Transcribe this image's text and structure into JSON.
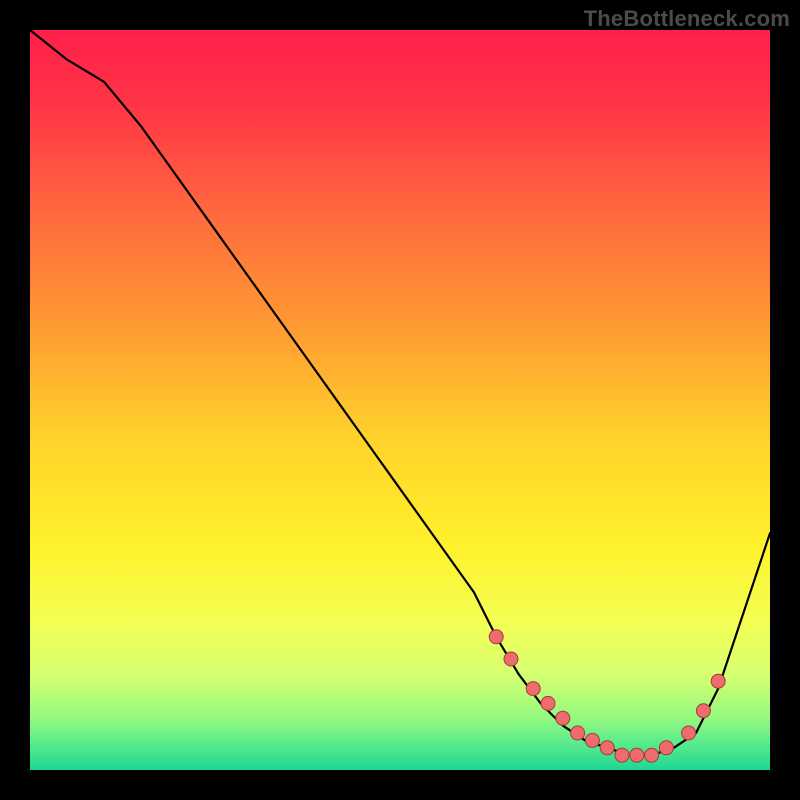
{
  "watermark": "TheBottleneck.com",
  "colors": {
    "background": "#000000",
    "gradient_stops": [
      {
        "offset": 0.0,
        "color": "#ff1f4a"
      },
      {
        "offset": 0.1,
        "color": "#ff3446"
      },
      {
        "offset": 0.25,
        "color": "#ff6a3e"
      },
      {
        "offset": 0.4,
        "color": "#ff9a33"
      },
      {
        "offset": 0.55,
        "color": "#ffd22a"
      },
      {
        "offset": 0.7,
        "color": "#fff22c"
      },
      {
        "offset": 0.8,
        "color": "#f3ff54"
      },
      {
        "offset": 0.87,
        "color": "#d6ff70"
      },
      {
        "offset": 0.93,
        "color": "#94f97f"
      },
      {
        "offset": 0.97,
        "color": "#4fe88e"
      },
      {
        "offset": 1.0,
        "color": "#1fd693"
      }
    ],
    "curve": "#000000",
    "marker_fill": "#ee6b6e",
    "marker_stroke": "#a83a3c"
  },
  "chart_data": {
    "type": "line",
    "title": "",
    "xlabel": "",
    "ylabel": "",
    "xlim": [
      0,
      100
    ],
    "ylim": [
      0,
      100
    ],
    "series": [
      {
        "name": "bottleneck-curve",
        "x": [
          0,
          5,
          10,
          15,
          20,
          25,
          30,
          35,
          40,
          45,
          50,
          55,
          60,
          63,
          66,
          69,
          72,
          75,
          78,
          81,
          84,
          87,
          90,
          93,
          96,
          100
        ],
        "y": [
          100,
          96,
          93,
          87,
          80,
          73,
          66,
          59,
          52,
          45,
          38,
          31,
          24,
          18,
          13,
          9,
          6,
          4,
          3,
          2,
          2,
          3,
          5,
          11,
          20,
          32
        ]
      }
    ],
    "markers": {
      "name": "highlight-dots",
      "x": [
        63,
        65,
        68,
        70,
        72,
        74,
        76,
        78,
        80,
        82,
        84,
        86,
        89,
        91,
        93
      ],
      "y": [
        18,
        15,
        11,
        9,
        7,
        5,
        4,
        3,
        2,
        2,
        2,
        3,
        5,
        8,
        12
      ]
    }
  }
}
